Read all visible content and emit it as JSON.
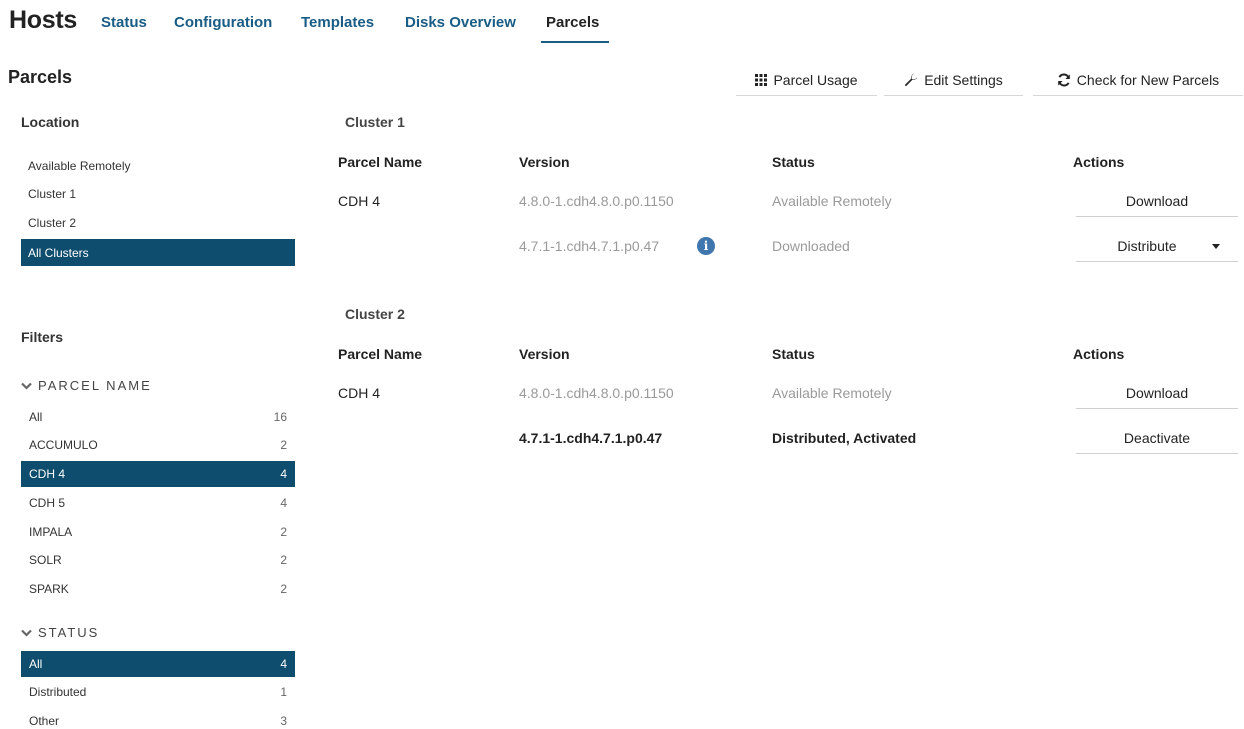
{
  "header": {
    "title": "Hosts",
    "tabs": [
      "Status",
      "Configuration",
      "Templates",
      "Disks Overview",
      "Parcels"
    ],
    "active_tab": "Parcels"
  },
  "section": {
    "title": "Parcels",
    "buttons": {
      "parcel_usage": "Parcel Usage",
      "edit_settings": "Edit Settings",
      "check_new": "Check for New Parcels"
    }
  },
  "location": {
    "heading": "Location",
    "items": [
      "Available Remotely",
      "Cluster 1",
      "Cluster 2",
      "All Clusters"
    ],
    "selected": "All Clusters"
  },
  "filters": {
    "heading": "Filters",
    "parcel_name": {
      "label": "PARCEL NAME",
      "items": [
        {
          "label": "All",
          "count": "16"
        },
        {
          "label": "ACCUMULO",
          "count": "2"
        },
        {
          "label": "CDH 4",
          "count": "4"
        },
        {
          "label": "CDH 5",
          "count": "4"
        },
        {
          "label": "IMPALA",
          "count": "2"
        },
        {
          "label": "SOLR",
          "count": "2"
        },
        {
          "label": "SPARK",
          "count": "2"
        }
      ],
      "selected": "CDH 4"
    },
    "status": {
      "label": "STATUS",
      "items": [
        {
          "label": "All",
          "count": "4"
        },
        {
          "label": "Distributed",
          "count": "1"
        },
        {
          "label": "Other",
          "count": "3"
        }
      ],
      "selected": "All"
    }
  },
  "columns": {
    "parcel_name": "Parcel Name",
    "version": "Version",
    "status": "Status",
    "actions": "Actions"
  },
  "clusters": [
    {
      "title": "Cluster 1",
      "rows": [
        {
          "parcel": "CDH 4",
          "version": "4.8.0-1.cdh4.8.0.p0.1150",
          "status": "Available Remotely",
          "action": "Download"
        },
        {
          "parcel": "",
          "version": "4.7.1-1.cdh4.7.1.p0.47",
          "status": "Downloaded",
          "action": "Distribute"
        }
      ]
    },
    {
      "title": "Cluster 2",
      "rows": [
        {
          "parcel": "CDH 4",
          "version": "4.8.0-1.cdh4.8.0.p0.1150",
          "status": "Available Remotely",
          "action": "Download"
        },
        {
          "parcel": "",
          "version": "4.7.1-1.cdh4.7.1.p0.47",
          "status": "Distributed, Activated",
          "action": "Deactivate"
        }
      ]
    }
  ],
  "colors": {
    "link": "#195c85",
    "selected_bg": "#0e4d6e",
    "info_icon": "#3f76ad",
    "muted_text": "#9a9a9a"
  }
}
